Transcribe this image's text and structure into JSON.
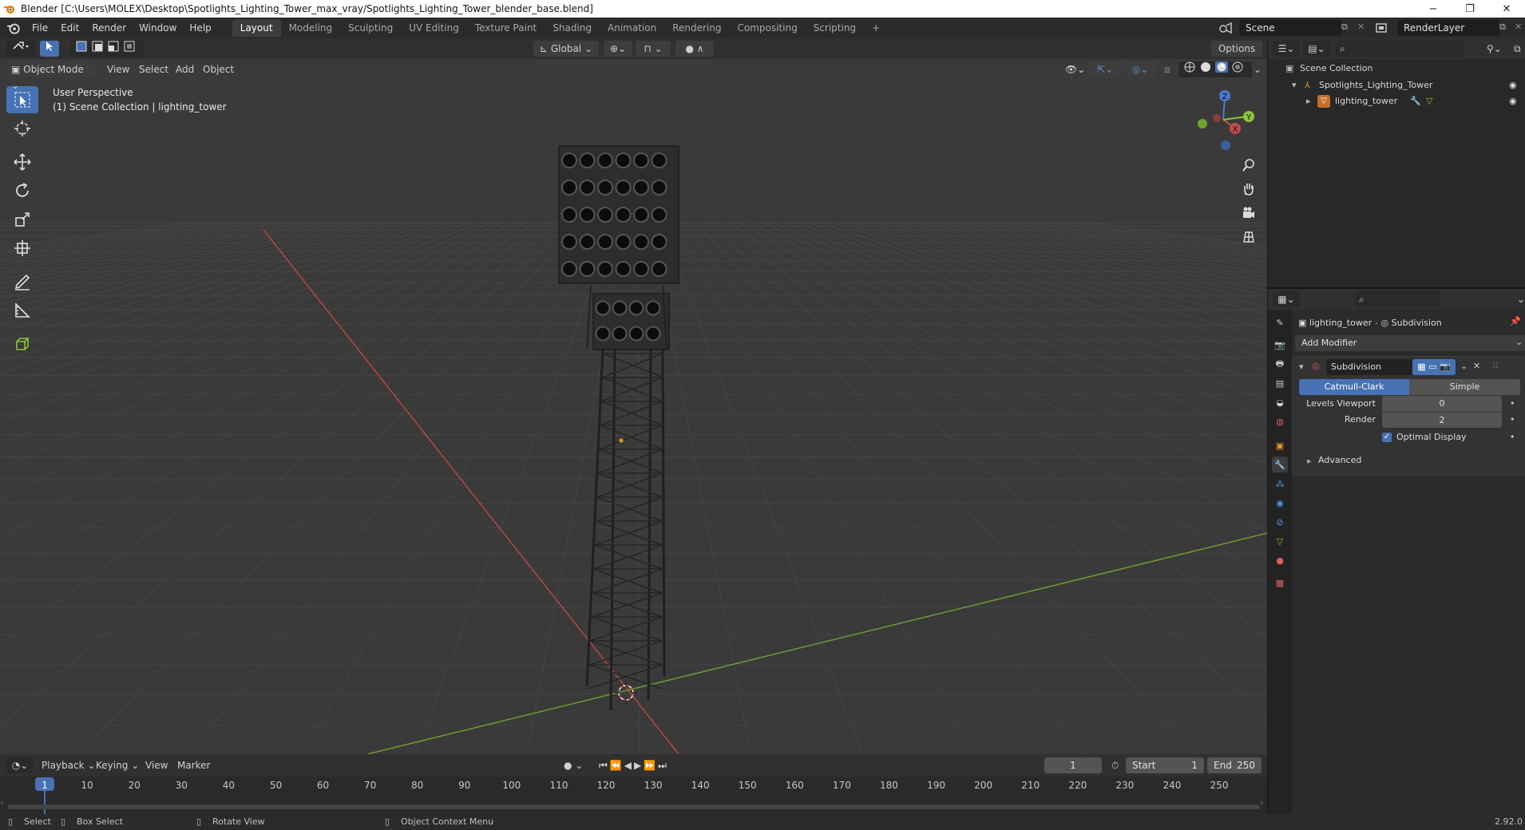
{
  "window": {
    "title": "Blender [C:\\Users\\MOLEX\\Desktop\\Spotlights_Lighting_Tower_max_vray/Spotlights_Lighting_Tower_blender_base.blend]",
    "minimize": "−",
    "restore": "❐",
    "close": "✕"
  },
  "menu": [
    "File",
    "Edit",
    "Render",
    "Window",
    "Help"
  ],
  "workspaces": [
    "Layout",
    "Modeling",
    "Sculpting",
    "UV Editing",
    "Texture Paint",
    "Shading",
    "Animation",
    "Rendering",
    "Compositing",
    "Scripting"
  ],
  "add_workspace": "+",
  "scene": {
    "name": "Scene",
    "render_layer": "RenderLayer"
  },
  "viewport": {
    "transform_orientation": "Global",
    "options_label": "Options",
    "mode": "Object Mode",
    "header_menu": [
      "View",
      "Select",
      "Add",
      "Object"
    ],
    "overlay_line1": "User Perspective",
    "overlay_line2": "(1) Scene Collection | lighting_tower",
    "gizmo_axes": [
      "X",
      "Y",
      "Z"
    ]
  },
  "timeline": {
    "menus": [
      "Playback",
      "Keying",
      "View",
      "Marker"
    ],
    "current_frame": "1",
    "start_label": "Start",
    "start_value": "1",
    "end_label": "End",
    "end_value": "250",
    "ticks": [
      "1",
      "10",
      "20",
      "30",
      "40",
      "50",
      "60",
      "70",
      "80",
      "90",
      "100",
      "110",
      "120",
      "130",
      "140",
      "150",
      "160",
      "170",
      "180",
      "190",
      "200",
      "210",
      "220",
      "230",
      "240",
      "250"
    ]
  },
  "status": {
    "select": "Select",
    "box_select": "Box Select",
    "rotate_view": "Rotate View",
    "context_menu": "Object Context Menu",
    "version": "2.92.0"
  },
  "outliner": {
    "root": "Scene Collection",
    "collection": "Spotlights_Lighting_Tower",
    "object": "lighting_tower"
  },
  "properties": {
    "breadcrumb_object": "lighting_tower",
    "breadcrumb_modifier": "Subdivision",
    "add_modifier": "Add Modifier",
    "modifier_name": "Subdivision",
    "type_catmull": "Catmull-Clark",
    "type_simple": "Simple",
    "levels_viewport_label": "Levels Viewport",
    "levels_viewport_value": "0",
    "render_label": "Render",
    "render_value": "2",
    "optimal_display_label": "Optimal Display",
    "advanced_label": "Advanced"
  },
  "colors": {
    "accent": "#4772b3",
    "x_axis": "#c64b4b",
    "y_axis": "#8ac43a",
    "z_axis": "#4a7bd0",
    "viewport_bg": "#3a3a3a",
    "grid": "#444444"
  }
}
